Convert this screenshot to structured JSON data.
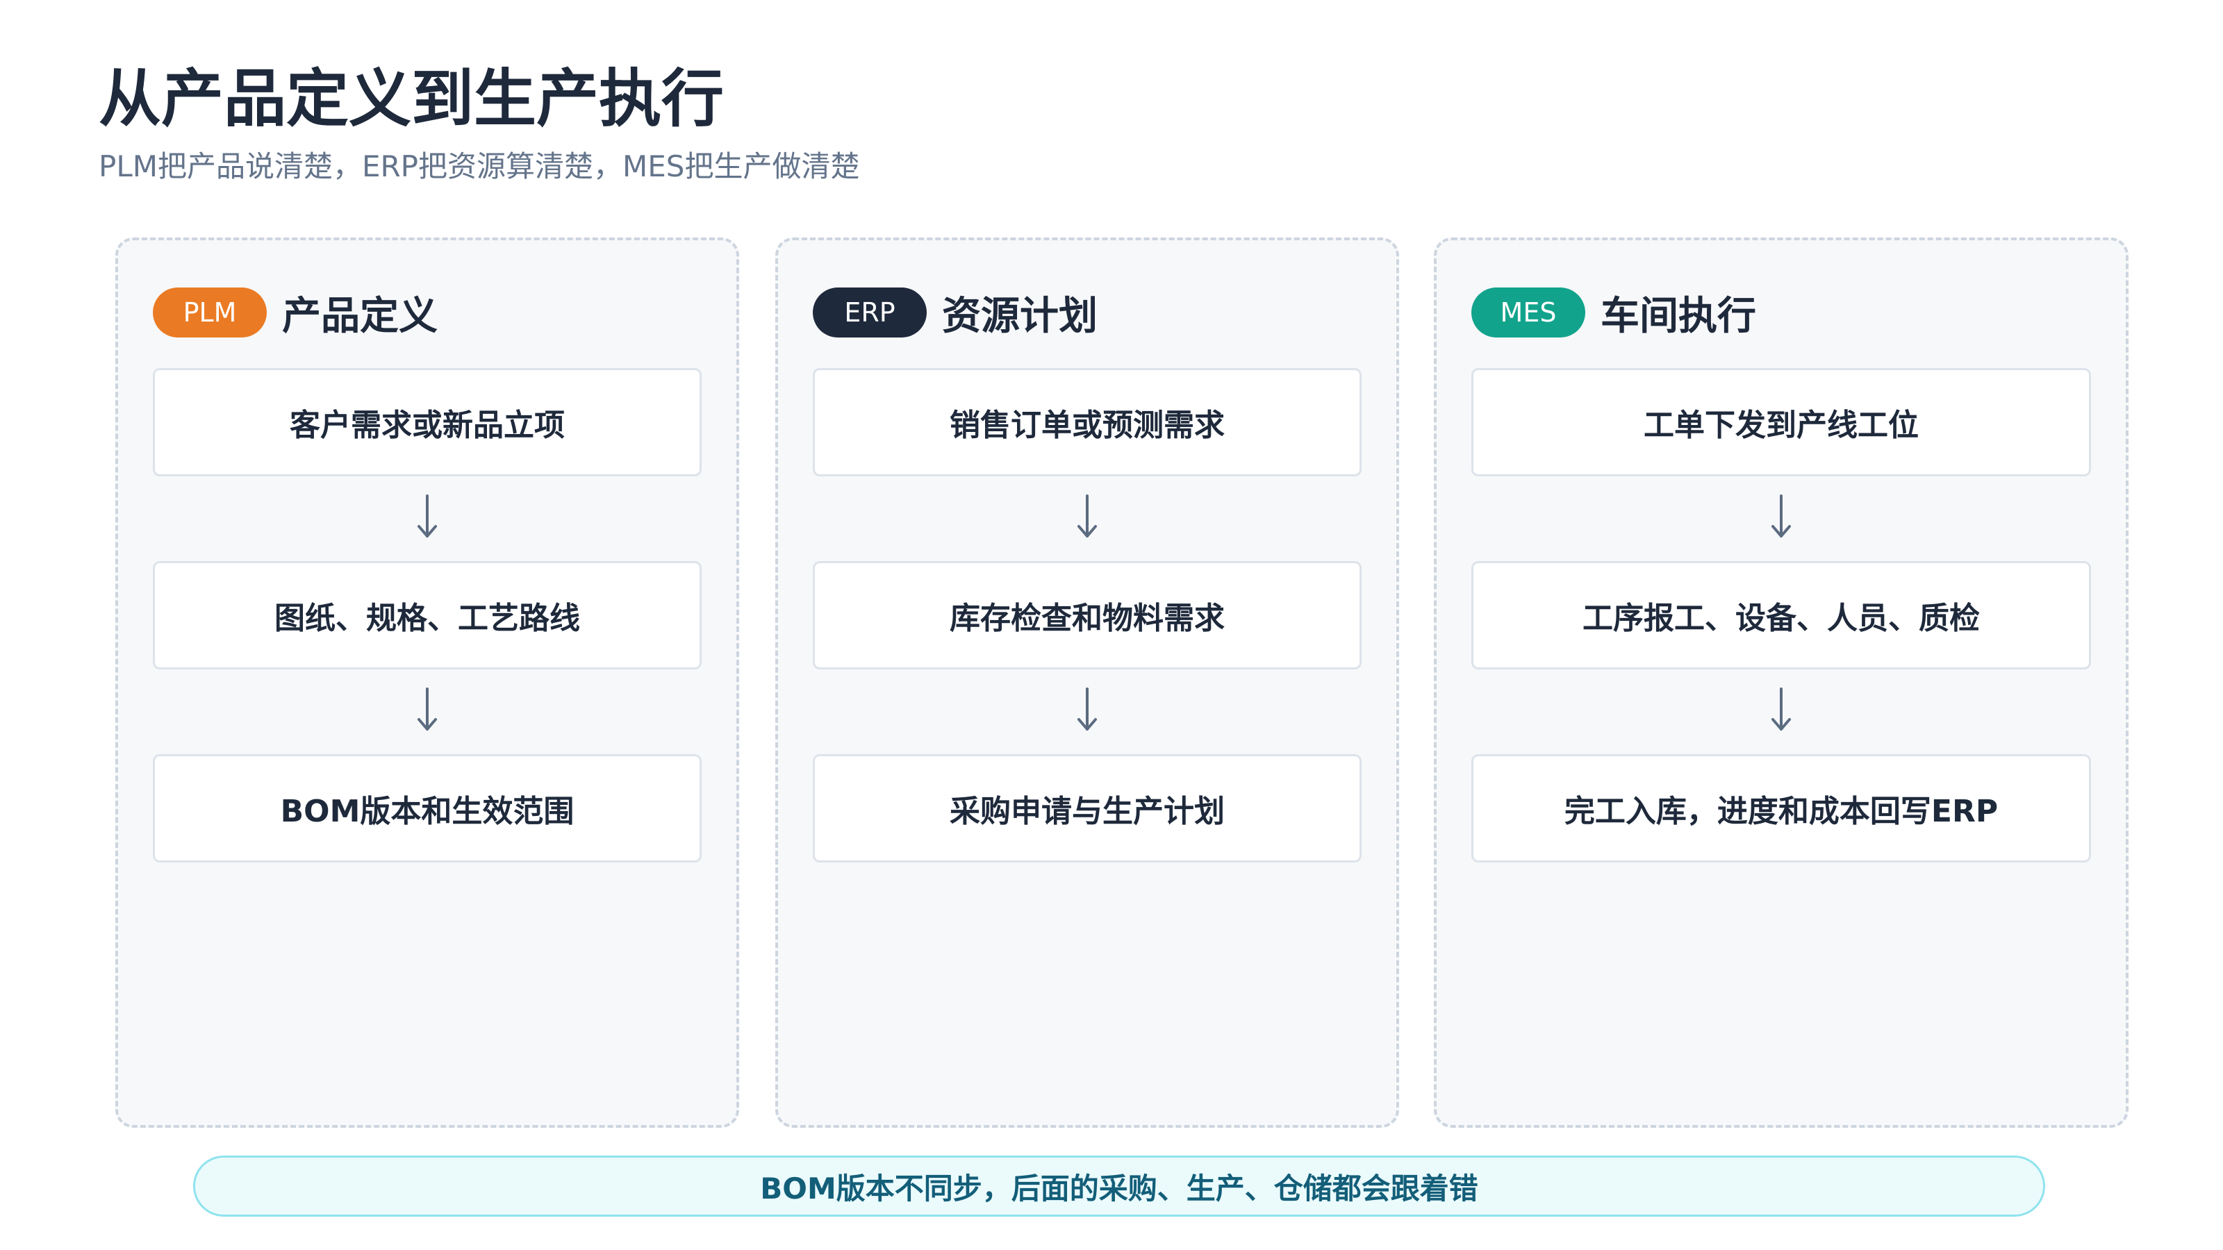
{
  "header": {
    "title": "从产品定义到生产执行",
    "subtitle": "PLM把产品说清楚，ERP把资源算清楚，MES把生产做清楚"
  },
  "columns": [
    {
      "badge": "PLM",
      "badge_color": "#ea7b24",
      "title": "产品定义",
      "steps": [
        "客户需求或新品立项",
        "图纸、规格、工艺路线",
        "BOM版本和生效范围"
      ]
    },
    {
      "badge": "ERP",
      "badge_color": "#1e293b",
      "title": "资源计划",
      "steps": [
        "销售订单或预测需求",
        "库存检查和物料需求",
        "采购申请与生产计划"
      ]
    },
    {
      "badge": "MES",
      "badge_color": "#12a38c",
      "title": "车间执行",
      "steps": [
        "工单下发到产线工位",
        "工序报工、设备、人员、质检",
        "完工入库，进度和成本回写ERP"
      ]
    }
  ],
  "icons": {
    "flow_arrow": "arrow-down-icon"
  },
  "footer_note": "BOM版本不同步，后面的采购、生产、仓储都会跟着错"
}
